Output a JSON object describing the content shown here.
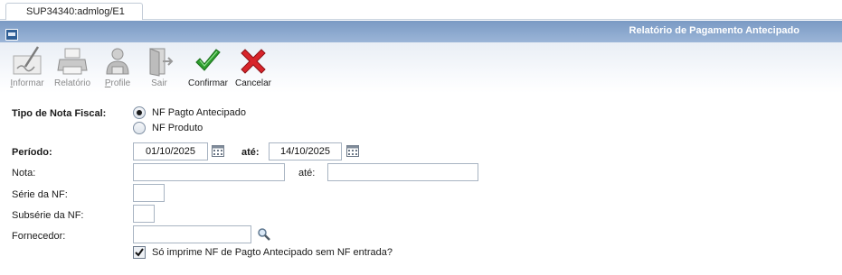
{
  "tab": {
    "label": "SUP34340:admlog/E1"
  },
  "window": {
    "title": "Relatório de Pagamento Antecipado"
  },
  "toolbar": {
    "informar": {
      "prefix": "I",
      "rest": "nformar",
      "enabled": false
    },
    "relatorio": {
      "label": "Relatório",
      "enabled": false
    },
    "profile": {
      "prefix": "P",
      "rest": "rofile",
      "enabled": false
    },
    "sair": {
      "label": "Sair",
      "enabled": false
    },
    "confirmar": {
      "label": "Confirmar",
      "enabled": true
    },
    "cancelar": {
      "label": "Cancelar",
      "enabled": true
    }
  },
  "form": {
    "tipo_label": "Tipo de Nota Fiscal:",
    "tipo_options": [
      {
        "label": "NF Pagto Antecipado",
        "selected": true
      },
      {
        "label": "NF Produto",
        "selected": false
      }
    ],
    "periodo_label": "Período:",
    "periodo_inicio": "01/10/2025",
    "periodo_ate_label": "até:",
    "periodo_fim": "14/10/2025",
    "nota_label": "Nota:",
    "nota_inicio": "",
    "nota_ate_label": "até:",
    "nota_fim": "",
    "serie_label": "Série da NF:",
    "serie_value": "",
    "subserie_label": "Subsérie da NF:",
    "subserie_value": "",
    "fornecedor_label": "Fornecedor:",
    "fornecedor_value": "",
    "so_imprime_label": "Só imprime NF de Pagto Antecipado sem NF entrada?",
    "so_imprime_checked": true
  },
  "colors": {
    "titlebar": "#8aa8cf",
    "confirm": "#2e9e2e",
    "cancel": "#d8242a"
  }
}
